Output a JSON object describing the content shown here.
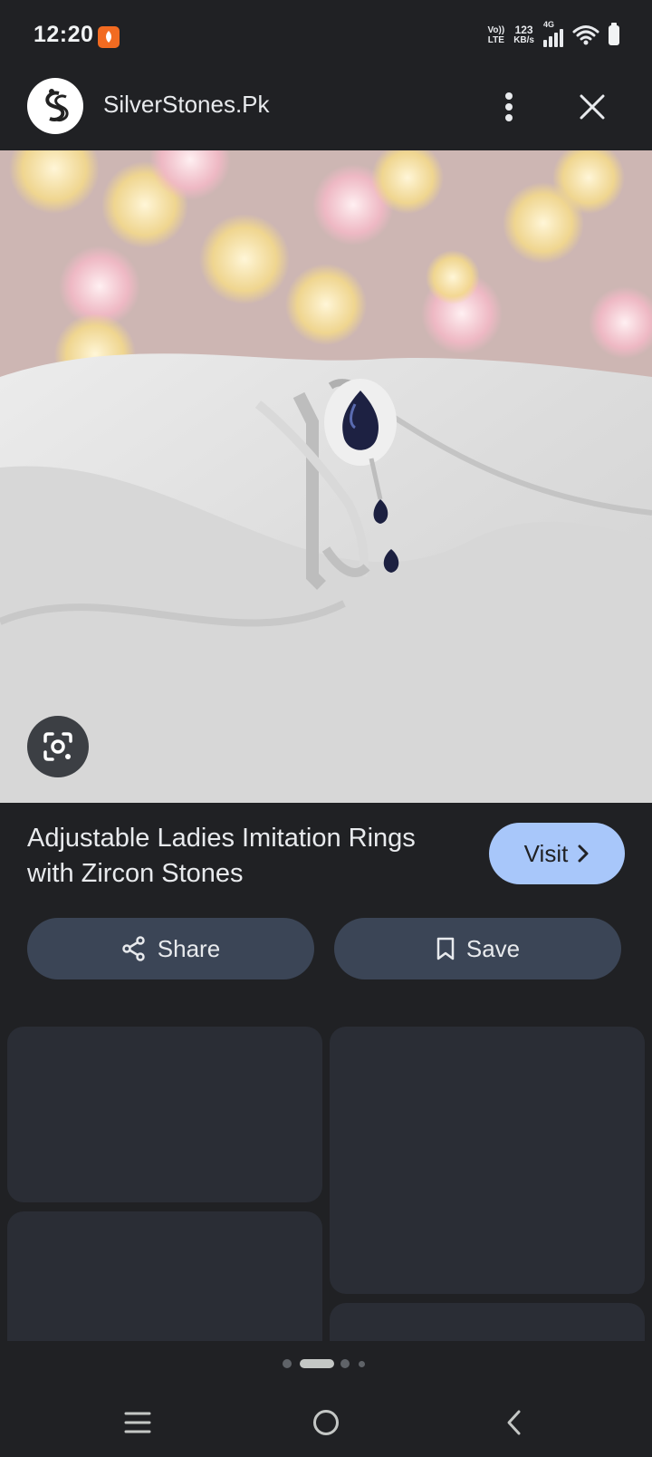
{
  "status_bar": {
    "time": "12:20",
    "network_top": "Vo))",
    "network_bottom": "LTE",
    "speed_top": "123",
    "speed_bottom": "KB/s",
    "cell_type": "4G"
  },
  "header": {
    "site_name": "SilverStones.Pk",
    "logo_icon": "silverstones-logo",
    "more_icon": "more-vert-icon",
    "close_icon": "close-icon"
  },
  "image": {
    "description_icon": "ring-photo",
    "lens_icon": "google-lens-icon"
  },
  "result": {
    "title": "Adjustable Ladies Imitation Rings with Zircon Stones",
    "visit_label": "Visit"
  },
  "actions": {
    "share_label": "Share",
    "save_label": "Save"
  },
  "pagination": {
    "total": 4,
    "active_index": 1
  },
  "colors": {
    "background": "#202124",
    "accent": "#a8c7fa",
    "button": "#3b4556",
    "card": "#2a2d35"
  }
}
